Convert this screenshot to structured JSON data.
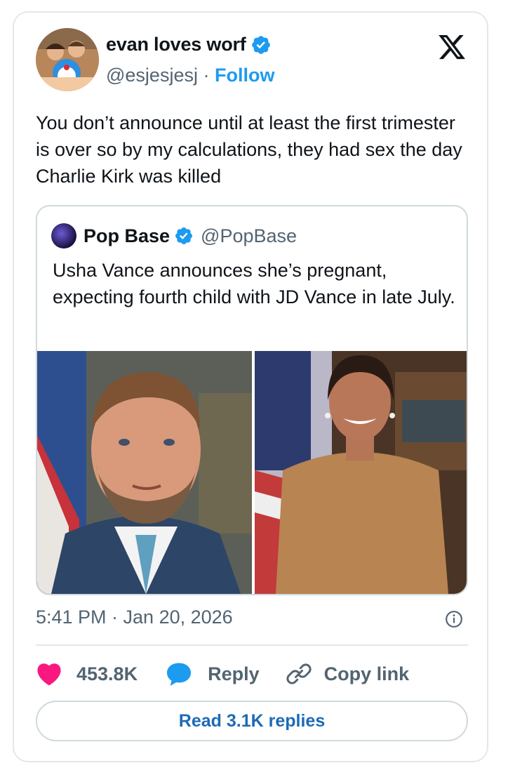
{
  "tweet": {
    "author": {
      "display_name": "evan loves worf",
      "handle": "@esjesjesj",
      "separator": "·",
      "follow_label": "Follow",
      "verified": true,
      "avatar_icon": "profile-photo"
    },
    "platform_icon": "x-logo-icon",
    "text": "You don’t announce until at least the first trimester is over so by my calculations, they had sex the day Charlie Kirk was killed",
    "quoted": {
      "display_name": "Pop Base",
      "handle": "@PopBase",
      "verified": true,
      "text": "Usha Vance announces she’s pregnant, expecting fourth child with JD Vance in late July.",
      "images": [
        "portrait-man-icon",
        "portrait-woman-icon"
      ]
    },
    "timestamp": "5:41 PM · Jan 20, 2026",
    "actions": {
      "likes": "453.8K",
      "reply_label": "Reply",
      "copy_label": "Copy link"
    },
    "read_replies_label": "Read 3.1K replies"
  },
  "colors": {
    "accent": "#1d9bf0",
    "like": "#f91880",
    "muted": "#536471",
    "border": "#cfd9de"
  }
}
